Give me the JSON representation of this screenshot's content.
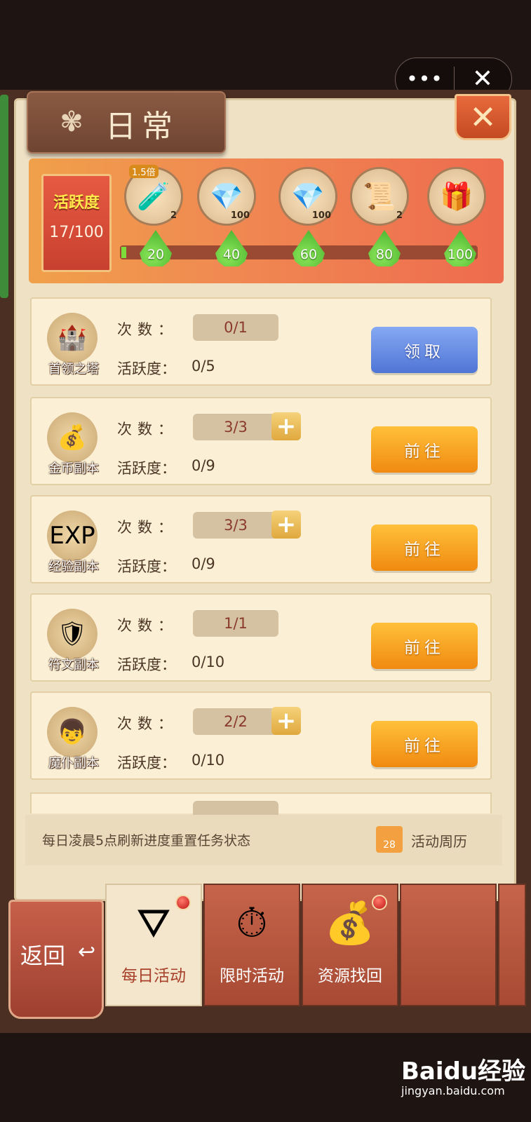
{
  "capsule": {
    "more": "•••",
    "close": "✕"
  },
  "panel": {
    "title": "日常",
    "close": "✕"
  },
  "activity": {
    "label": "活跃度",
    "value": "17/100",
    "progress_fraction": 0.17,
    "rewards": [
      {
        "icon": "potion-icon",
        "glyph": "🧪",
        "count": "2",
        "tag": "1.5倍"
      },
      {
        "icon": "diamond-icon",
        "glyph": "💎",
        "count": "100"
      },
      {
        "icon": "diamond-icon",
        "glyph": "💎",
        "count": "100"
      },
      {
        "icon": "scroll-icon",
        "glyph": "📜",
        "count": "2"
      },
      {
        "icon": "gift-box-icon",
        "glyph": "🎁",
        "count": ""
      }
    ],
    "milestones": [
      "20",
      "40",
      "60",
      "80",
      "100"
    ]
  },
  "tasks": [
    {
      "name": "首领之塔",
      "icon": "tower-icon",
      "glyph": "🏰",
      "times_label": "次数：",
      "times": "0/1",
      "plus": false,
      "act_label": "活跃度：",
      "act": "0/5",
      "button": "领取",
      "style": "blue"
    },
    {
      "name": "金币副本",
      "icon": "gold-coins-icon",
      "glyph": "💰",
      "times_label": "次数：",
      "times": "3/3",
      "plus": true,
      "act_label": "活跃度：",
      "act": "0/9",
      "button": "前往",
      "style": "orange"
    },
    {
      "name": "经验副本",
      "icon": "exp-orb-icon",
      "glyph": "EXP",
      "times_label": "次数：",
      "times": "3/3",
      "plus": true,
      "act_label": "活跃度：",
      "act": "0/9",
      "button": "前往",
      "style": "orange"
    },
    {
      "name": "符文副本",
      "icon": "rune-icon",
      "glyph": "🛡",
      "times_label": "次数：",
      "times": "1/1",
      "plus": false,
      "act_label": "活跃度：",
      "act": "0/10",
      "button": "前往",
      "style": "orange"
    },
    {
      "name": "魔仆副本",
      "icon": "character-icon",
      "glyph": "👦",
      "times_label": "次数：",
      "times": "2/2",
      "plus": true,
      "act_label": "活跃度：",
      "act": "0/10",
      "button": "前往",
      "style": "orange"
    }
  ],
  "footer": {
    "note": "每日凌晨5点刷新进度重置任务状态",
    "calendar_day": "28",
    "calendar_label": "活动周历"
  },
  "tabs": {
    "back": "返回",
    "items": [
      {
        "label": "每日活动",
        "icon": "daily-icon",
        "glyph": "⛛",
        "active": true,
        "dot": true
      },
      {
        "label": "限时活动",
        "icon": "stopwatch-icon",
        "glyph": "⏱",
        "active": false,
        "dot": false
      },
      {
        "label": "资源找回",
        "icon": "money-bag-icon",
        "glyph": "💰",
        "active": false,
        "dot": true
      }
    ]
  },
  "watermark": {
    "brand": "Baidu经验",
    "url": "jingyan.baidu.com"
  },
  "colors": {
    "primary_orange": "#f08a10",
    "primary_blue": "#4f75d6",
    "panel_bg": "#efe1c4",
    "board_bg": "#4a2f22"
  }
}
